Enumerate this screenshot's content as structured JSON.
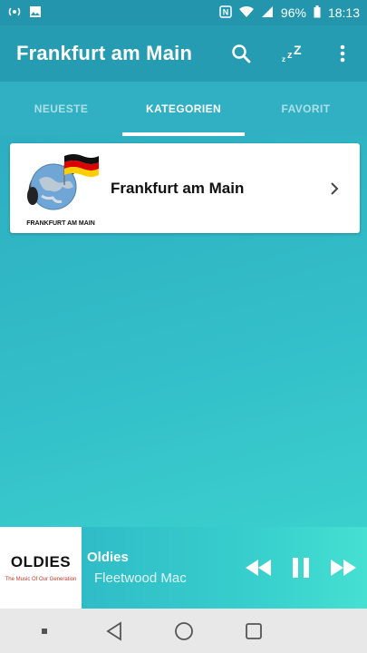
{
  "status": {
    "battery": "96%",
    "time": "18:13"
  },
  "app": {
    "title": "Frankfurt am Main"
  },
  "icons": {
    "search": "search-icon",
    "sleep": "sleep-timer-icon",
    "menu": "more-vert-icon"
  },
  "tabs": [
    {
      "label": "NEUESTE",
      "active": false
    },
    {
      "label": "KATEGORIEN",
      "active": true
    },
    {
      "label": "FAVORIT",
      "active": false
    }
  ],
  "card": {
    "title": "Frankfurt am Main",
    "logo_caption": "FRANKFURT AM MAIN"
  },
  "player": {
    "art_title": "OLDIES",
    "art_subtitle": "The Music Of Our Generation",
    "track_title": "Oldies",
    "track_artist": "Fleetwood Mac"
  },
  "colors": {
    "accent": "#2aa6bd",
    "card_bg": "#ffffff",
    "nav_bg": "#e8e8e8"
  }
}
